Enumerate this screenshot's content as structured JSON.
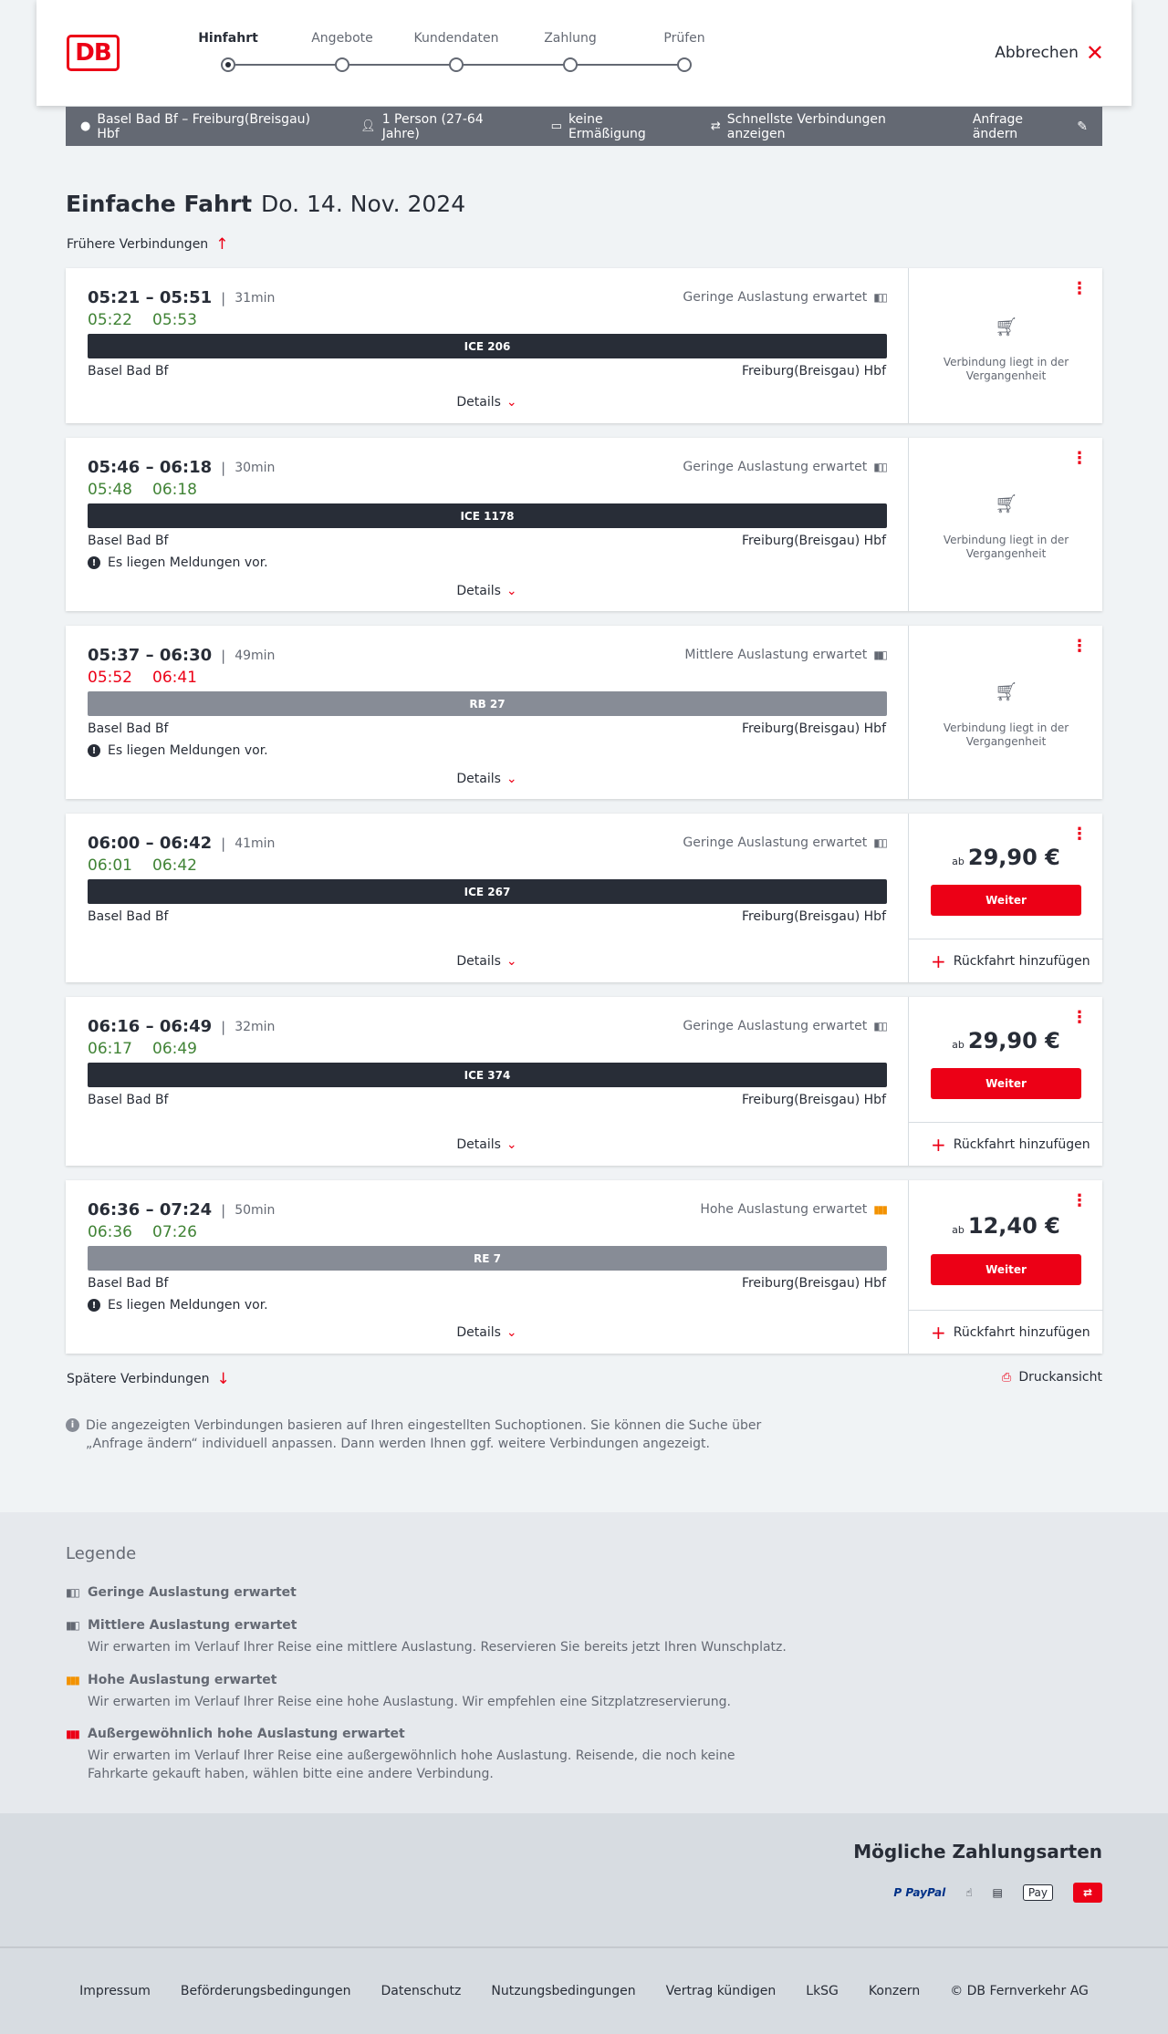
{
  "header": {
    "logo": "DB",
    "steps": [
      {
        "label": "Hinfahrt",
        "active": true
      },
      {
        "label": "Angebote",
        "active": false
      },
      {
        "label": "Kundendaten",
        "active": false
      },
      {
        "label": "Zahlung",
        "active": false
      },
      {
        "label": "Prüfen",
        "active": false
      }
    ],
    "cancel_label": "Abbrechen"
  },
  "search": {
    "route": "Basel Bad Bf – Freiburg(Breisgau) Hbf",
    "travellers": "1 Person (27-64 Jahre)",
    "discount": "keine Ermäßigung",
    "fastest": "Schnellste Verbindungen anzeigen",
    "change": "Anfrage ändern"
  },
  "page": {
    "title_bold": "Einfache Fahrt",
    "date": "Do. 14. Nov. 2024",
    "earlier": "Frühere Verbindungen",
    "later": "Spätere Verbindungen",
    "print": "Druckansicht",
    "info": "Die angezeigten Verbindungen basieren auf Ihren eingestellten Suchoptionen. Sie können die Suche über „Anfrage ändern“ individuell anpassen. Dann werden Ihnen ggf. weitere Verbindungen angezeigt."
  },
  "labels": {
    "details": "Details",
    "past": "Verbindung liegt in der Vergangenheit",
    "weiter": "Weiter",
    "return": "Rückfahrt hinzufügen",
    "from_prefix": "ab",
    "message": "Es liegen Meldungen vor."
  },
  "connections": [
    {
      "times": "05:21 – 05:51",
      "duration": "31min",
      "rt_dep": "05:22",
      "rt_arr": "05:53",
      "rt_status": "ok",
      "load": "Geringe Auslastung erwartet",
      "load_level": "low",
      "train": "ICE 206",
      "from": "Basel Bad Bf",
      "to": "Freiburg(Breisgau) Hbf",
      "message": false,
      "past": true
    },
    {
      "times": "05:46 – 06:18",
      "duration": "30min",
      "rt_dep": "05:48",
      "rt_arr": "06:18",
      "rt_status": "ok",
      "load": "Geringe Auslastung erwartet",
      "load_level": "low",
      "train": "ICE 1178",
      "from": "Basel Bad Bf",
      "to": "Freiburg(Breisgau) Hbf",
      "message": true,
      "past": true
    },
    {
      "times": "05:37 – 06:30",
      "duration": "49min",
      "rt_dep": "05:52",
      "rt_arr": "06:41",
      "rt_status": "late",
      "load": "Mittlere Auslastung erwartet",
      "load_level": "medium",
      "train": "RB 27",
      "from": "Basel Bad Bf",
      "to": "Freiburg(Breisgau) Hbf",
      "message": true,
      "past": true
    },
    {
      "times": "06:00 – 06:42",
      "duration": "41min",
      "rt_dep": "06:01",
      "rt_arr": "06:42",
      "rt_status": "ok",
      "load": "Geringe Auslastung erwartet",
      "load_level": "low",
      "train": "ICE 267",
      "from": "Basel Bad Bf",
      "to": "Freiburg(Breisgau) Hbf",
      "message": false,
      "past": false,
      "price": "29,90 €"
    },
    {
      "times": "06:16 – 06:49",
      "duration": "32min",
      "rt_dep": "06:17",
      "rt_arr": "06:49",
      "rt_status": "ok",
      "load": "Geringe Auslastung erwartet",
      "load_level": "low",
      "train": "ICE 374",
      "from": "Basel Bad Bf",
      "to": "Freiburg(Breisgau) Hbf",
      "message": false,
      "past": false,
      "price": "29,90 €"
    },
    {
      "times": "06:36 – 07:24",
      "duration": "50min",
      "rt_dep": "06:36",
      "rt_arr": "07:26",
      "rt_status": "ok",
      "load": "Hohe Auslastung erwartet",
      "load_level": "high",
      "train": "RE 7",
      "from": "Basel Bad Bf",
      "to": "Freiburg(Breisgau) Hbf",
      "message": true,
      "past": false,
      "price": "12,40 €"
    }
  ],
  "legend": {
    "title": "Legende",
    "items": [
      {
        "title": "Geringe Auslastung erwartet",
        "desc": ""
      },
      {
        "title": "Mittlere Auslastung erwartet",
        "desc": "Wir erwarten im Verlauf Ihrer Reise eine mittlere Auslastung. Reservieren Sie bereits jetzt Ihren Wunschplatz."
      },
      {
        "title": "Hohe Auslastung erwartet",
        "desc": "Wir erwarten im Verlauf Ihrer Reise eine hohe Auslastung. Wir empfehlen eine Sitzplatzreservierung."
      },
      {
        "title": "Außergewöhnlich hohe Auslastung erwartet",
        "desc": "Wir erwarten im Verlauf Ihrer Reise eine außergewöhnlich hohe Auslastung. Reisende, die noch keine Fahrkarte gekauft haben, wählen bitte eine andere Verbindung."
      }
    ]
  },
  "payment": {
    "title": "Mögliche Zahlungsarten",
    "methods": [
      "PayPal",
      "Pay",
      "DB"
    ],
    "paypal_label": "P PayPal",
    "apple_label": "Pay"
  },
  "footer": {
    "links": [
      "Impressum",
      "Beförderungsbedingungen",
      "Datenschutz",
      "Nutzungsbedingungen",
      "Vertrag kündigen",
      "LkSG",
      "Konzern",
      "© DB Fernverkehr AG"
    ]
  },
  "colors": {
    "brand": "#ec0016",
    "ok": "#408335",
    "dark": "#282d37",
    "high_load": "#f39200"
  }
}
